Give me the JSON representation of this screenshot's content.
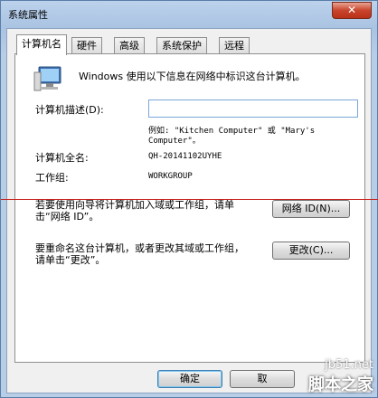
{
  "window": {
    "title": "系统属性",
    "close_label": "✕"
  },
  "tabs": [
    {
      "label": "计算机名",
      "active": true
    },
    {
      "label": "硬件",
      "active": false
    },
    {
      "label": "高级",
      "active": false
    },
    {
      "label": "系统保护",
      "active": false
    },
    {
      "label": "远程",
      "active": false
    }
  ],
  "panel": {
    "intro": "Windows 使用以下信息在网络中标识这台计算机。",
    "description_label": "计算机描述(D):",
    "description_value": "",
    "example_line1": "例如: \"Kitchen Computer\" 或 \"Mary's",
    "example_line2": "Computer\"。",
    "fullname_label": "计算机全名:",
    "fullname_value": "QH-20141102UYHE",
    "workgroup_label": "工作组:",
    "workgroup_value": "WORKGROUP",
    "network_text_line1": "若要使用向导将计算机加入域或工作组，请单",
    "network_text_line2": "击“网络 ID”。",
    "network_id_button": "网络 ID(N)...",
    "rename_text_line1": "要重命名这台计算机，或者更改其域或工作组，",
    "rename_text_line2": "请单击“更改”。",
    "change_button": "更改(C)..."
  },
  "footer": {
    "ok_button": "确定",
    "cancel_button": "取"
  },
  "watermark": {
    "site": "jb51.net",
    "name": "脚本之家"
  },
  "colors": {
    "accent": "#3c7fb1",
    "redline": "#c8201c"
  }
}
